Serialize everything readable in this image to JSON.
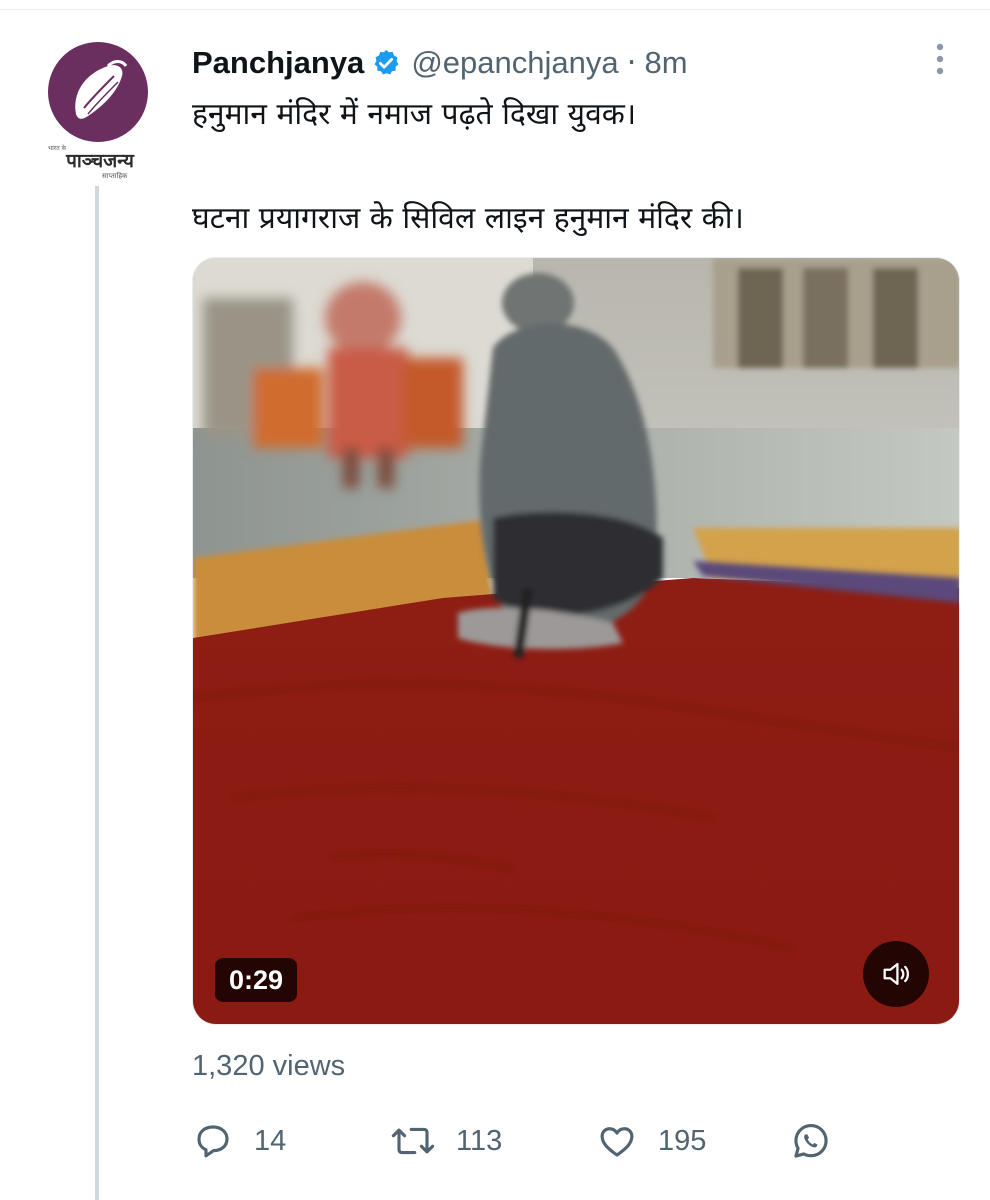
{
  "tweet": {
    "author": {
      "display_name": "Panchjanya",
      "handle": "@epanchjanya",
      "avatar_logo_text": "पाञ्चजन्य",
      "avatar_small_top": "भारत के",
      "avatar_small_bottom": "साप्ताहिक"
    },
    "separator": "·",
    "timestamp": "8m",
    "text_line_1": "हनुमान मंदिर में नमाज पढ़ते दिखा युवक।",
    "text_line_2": "घटना प्रयागराज के सिविल लाइन हनुमान मंदिर की।",
    "video": {
      "duration": "0:29",
      "sound_state": "muted"
    },
    "views": "1,320 views",
    "actions": {
      "replies": "14",
      "retweets": "113",
      "likes": "195"
    }
  },
  "icons": {
    "verified": "verified-badge-icon",
    "more": "more-options-icon",
    "reply": "reply-icon",
    "retweet": "retweet-icon",
    "like": "heart-icon",
    "share": "whatsapp-icon",
    "volume": "speaker-icon"
  },
  "colors": {
    "verified_blue": "#1d9bf0",
    "secondary_text": "#536471",
    "primary_text": "#0f1419",
    "avatar_purple": "#6a2f5e"
  }
}
